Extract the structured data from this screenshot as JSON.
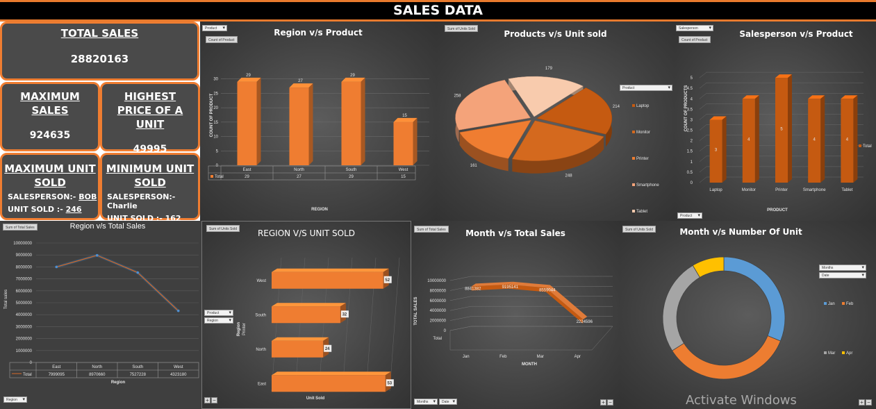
{
  "title": "SALES DATA",
  "kpis": {
    "total_sales": {
      "label": "TOTAL SALES",
      "value": "28820163"
    },
    "max_sales": {
      "label": "MAXIMUM SALES",
      "value": "924635"
    },
    "highest_price": {
      "label": "HIGHEST PRICE OF A UNIT",
      "value": "49995"
    },
    "max_unit": {
      "label": "MAXIMUM UNIT SOLD",
      "sp_label": "SALESPERSON:- ",
      "sp_value": "BOB",
      "unit_label": "UNIT SOLD :- ",
      "unit_value": "246"
    },
    "min_unit": {
      "label": "MINIMUM UNIT SOLD",
      "sp_label": "SALESPERSON:-",
      "sp_value": "Charlie",
      "unit_label": "UNIT SOLD :- ",
      "unit_value": "162"
    }
  },
  "buttons": {
    "product": "Product",
    "count_of_product": "Count of Product",
    "sum_units_sold": "Sum of Units Sold",
    "salesperson": "Salesperson",
    "sum_total_sales": "Sum of Total Sales",
    "region": "Region",
    "months": "Months",
    "date": "Date",
    "product2": "Product",
    "legend_total": "Total"
  },
  "watermark": "Activate Windows",
  "chart_data": [
    {
      "id": "region_product",
      "type": "bar",
      "title": "Region v/s Product",
      "xlabel": "REGION",
      "ylabel": "COUNT OF PRODUCT",
      "categories": [
        "East",
        "North",
        "South",
        "West"
      ],
      "series": [
        {
          "name": "Total",
          "values": [
            29,
            27,
            29,
            15
          ]
        }
      ],
      "yticks": [
        "0",
        "5",
        "10",
        "15",
        "20",
        "25",
        "30"
      ],
      "ylim": [
        0,
        35
      ],
      "color": "#ef7d31"
    },
    {
      "id": "products_units",
      "type": "pie",
      "title": "Products v/s Unit sold",
      "categories": [
        "Laptop",
        "Monitor",
        "Printer",
        "Smartphone",
        "Tablet"
      ],
      "values": [
        214,
        248,
        161,
        258,
        179
      ],
      "legend_title": "Product",
      "colors": [
        "#c55a11",
        "#d4691e",
        "#ef7d31",
        "#f4a37a",
        "#f8cbad"
      ]
    },
    {
      "id": "salesperson_product",
      "type": "bar",
      "title": "Salesperson v/s Product",
      "xlabel": "PRODUCT",
      "ylabel": "COUNT OF PRODUCTS",
      "categories": [
        "Laptop",
        "Monitor",
        "Printer",
        "Smartphone",
        "Tablet"
      ],
      "series": [
        {
          "name": "Total",
          "values": [
            3,
            4,
            5,
            4,
            4
          ]
        }
      ],
      "yticks": [
        "0",
        "0.5",
        "1",
        "1.5",
        "2",
        "2.5",
        "3",
        "3.5",
        "4",
        "4.5",
        "5"
      ],
      "ylim": [
        0,
        5.5
      ],
      "color": "#c55a11"
    },
    {
      "id": "region_total_sales",
      "type": "line",
      "title": "Region v/s Total Sales",
      "xlabel": "Region",
      "ylabel": "Total sales",
      "categories": [
        "East",
        "North",
        "South",
        "West"
      ],
      "series": [
        {
          "name": "Total",
          "values": [
            7999095,
            8970660,
            7527228,
            4323180
          ]
        }
      ],
      "yticks": [
        "0",
        "1000000",
        "2000000",
        "3000000",
        "4000000",
        "5000000",
        "6000000",
        "7000000",
        "8000000",
        "9000000",
        "10000000"
      ],
      "ylim": [
        0,
        10000000
      ],
      "color": "#2e75b6"
    },
    {
      "id": "region_unit_sold",
      "type": "bar",
      "orientation": "horizontal",
      "title": "REGION V/S UNIT SOLD",
      "xlabel": "Unit Sold",
      "ylabel": "Region",
      "ylabel2": "Printer",
      "categories": [
        "East",
        "North",
        "South",
        "West"
      ],
      "series": [
        {
          "name": "Total",
          "values": [
            53,
            24,
            32,
            52
          ]
        }
      ],
      "xlim": [
        0,
        55
      ],
      "color": "#ef7d31"
    },
    {
      "id": "month_total_sales",
      "type": "line",
      "title": "Month v/s Total Sales",
      "xlabel": "MONTH",
      "ylabel": "TOTAL SALES",
      "categories": [
        "Jan",
        "Feb",
        "Mar",
        "Apr"
      ],
      "series": [
        {
          "name": "Total",
          "values": [
            8841382,
            9195141,
            8559044,
            2224596
          ]
        }
      ],
      "yticks": [
        "0",
        "2000000",
        "4000000",
        "6000000",
        "8000000",
        "10000000"
      ],
      "ylim": [
        0,
        10000000
      ],
      "color": "#c55a11"
    },
    {
      "id": "month_units",
      "type": "pie",
      "title": "Month v/s Number Of Unit",
      "categories": [
        "Jan",
        "Feb",
        "Mar",
        "Apr"
      ],
      "values": [
        330,
        370,
        270,
        90
      ],
      "colors": [
        "#5b9bd5",
        "#ed7d31",
        "#a5a5a5",
        "#ffc000"
      ]
    }
  ]
}
